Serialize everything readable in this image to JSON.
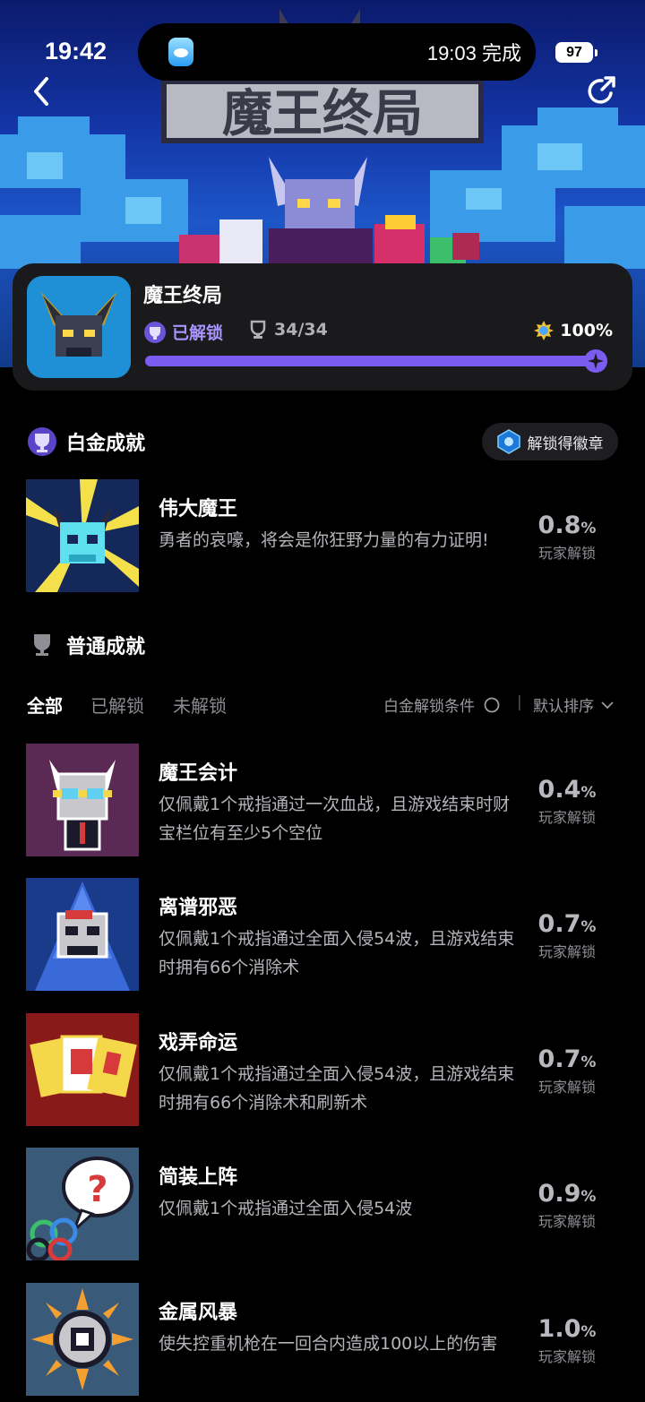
{
  "status_bar": {
    "time": "19:42",
    "island_text": "19:03 完成",
    "battery": "97"
  },
  "banner": {
    "logo_text": "魔王终局"
  },
  "game": {
    "title": "魔王终局",
    "unlocked_label": "已解锁",
    "count": "34/34",
    "percent": "100%",
    "progress": 1.0,
    "accent": "#7a5cf0"
  },
  "platinum": {
    "heading": "白金成就",
    "badge_button": "解锁得徽章",
    "item": {
      "title": "伟大魔王",
      "desc": "勇者的哀嚎，将会是你狂野力量的有力证明!",
      "rate": "0.8",
      "rate_unit": "%",
      "rate_label": "玩家解锁"
    }
  },
  "normal": {
    "heading": "普通成就",
    "tabs": [
      "全部",
      "已解锁",
      "未解锁"
    ],
    "condition_label": "白金解锁条件",
    "sort_label": "默认排序",
    "items": [
      {
        "title": "魔王会计",
        "desc": "仅佩戴1个戒指通过一次血战，且游戏结束时财宝栏位有至少5个空位",
        "rate": "0.4",
        "rate_unit": "%",
        "rate_label": "玩家解锁"
      },
      {
        "title": "离谱邪恶",
        "desc": "仅佩戴1个戒指通过全面入侵54波，且游戏结束时拥有66个消除术",
        "rate": "0.7",
        "rate_unit": "%",
        "rate_label": "玩家解锁"
      },
      {
        "title": "戏弄命运",
        "desc": "仅佩戴1个戒指通过全面入侵54波，且游戏结束时拥有66个消除术和刷新术",
        "rate": "0.7",
        "rate_unit": "%",
        "rate_label": "玩家解锁"
      },
      {
        "title": "简装上阵",
        "desc": "仅佩戴1个戒指通过全面入侵54波",
        "rate": "0.9",
        "rate_unit": "%",
        "rate_label": "玩家解锁"
      },
      {
        "title": "金属风暴",
        "desc": "使失控重机枪在一回合内造成100以上的伤害",
        "rate": "1.0",
        "rate_unit": "%",
        "rate_label": "玩家解锁"
      }
    ]
  }
}
